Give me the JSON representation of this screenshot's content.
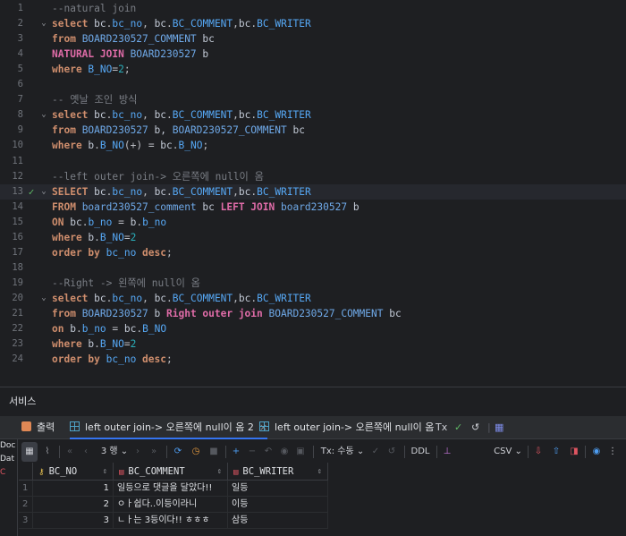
{
  "editor": {
    "lines": [
      {
        "n": "1",
        "fold": "",
        "icon": "",
        "tokens": [
          [
            "cmt",
            "--natural join"
          ]
        ]
      },
      {
        "n": "2",
        "fold": "v",
        "icon": "",
        "tokens": [
          [
            "kw",
            "select "
          ],
          [
            "ident",
            "bc"
          ],
          [
            "punct",
            "."
          ],
          [
            "col",
            "bc_no"
          ],
          [
            "punct",
            ", "
          ],
          [
            "ident",
            "bc"
          ],
          [
            "punct",
            "."
          ],
          [
            "col",
            "BC_COMMENT"
          ],
          [
            "punct",
            ","
          ],
          [
            "ident",
            "bc"
          ],
          [
            "punct",
            "."
          ],
          [
            "col",
            "BC_WRITER"
          ]
        ]
      },
      {
        "n": "3",
        "fold": "",
        "icon": "",
        "tokens": [
          [
            "kw",
            "from "
          ],
          [
            "tbl",
            "BOARD230527_COMMENT"
          ],
          [
            "ident",
            " bc"
          ]
        ]
      },
      {
        "n": "4",
        "fold": "",
        "icon": "",
        "tokens": [
          [
            "kwp",
            "NATURAL JOIN "
          ],
          [
            "tbl",
            "BOARD230527"
          ],
          [
            "ident",
            " b"
          ]
        ]
      },
      {
        "n": "5",
        "fold": "",
        "icon": "",
        "tokens": [
          [
            "kw",
            "where "
          ],
          [
            "col",
            "B_NO"
          ],
          [
            "punct",
            "="
          ],
          [
            "num",
            "2"
          ],
          [
            "punct",
            ";"
          ]
        ]
      },
      {
        "n": "6",
        "fold": "",
        "icon": "",
        "tokens": []
      },
      {
        "n": "7",
        "fold": "",
        "icon": "",
        "tokens": [
          [
            "cmt",
            "-- 옛날 조인 방식"
          ]
        ]
      },
      {
        "n": "8",
        "fold": "v",
        "icon": "",
        "tokens": [
          [
            "kw",
            "select "
          ],
          [
            "ident",
            "bc"
          ],
          [
            "punct",
            "."
          ],
          [
            "col",
            "bc_no"
          ],
          [
            "punct",
            ", "
          ],
          [
            "ident",
            "bc"
          ],
          [
            "punct",
            "."
          ],
          [
            "col",
            "BC_COMMENT"
          ],
          [
            "punct",
            ","
          ],
          [
            "ident",
            "bc"
          ],
          [
            "punct",
            "."
          ],
          [
            "col",
            "BC_WRITER"
          ]
        ]
      },
      {
        "n": "9",
        "fold": "",
        "icon": "",
        "tokens": [
          [
            "kw",
            "from "
          ],
          [
            "tbl",
            "BOARD230527"
          ],
          [
            "ident",
            " b, "
          ],
          [
            "tbl",
            "BOARD230527_COMMENT"
          ],
          [
            "ident",
            " bc"
          ]
        ]
      },
      {
        "n": "10",
        "fold": "",
        "icon": "",
        "tokens": [
          [
            "kw",
            "where "
          ],
          [
            "ident",
            "b"
          ],
          [
            "punct",
            "."
          ],
          [
            "col",
            "B_NO"
          ],
          [
            "punct",
            "(+) = "
          ],
          [
            "ident",
            "bc"
          ],
          [
            "punct",
            "."
          ],
          [
            "col",
            "B_NO"
          ],
          [
            "punct",
            ";"
          ]
        ]
      },
      {
        "n": "11",
        "fold": "",
        "icon": "",
        "tokens": []
      },
      {
        "n": "12",
        "fold": "",
        "icon": "",
        "tokens": [
          [
            "cmt",
            "--left outer join-> 오른쪽에 null이 옴"
          ]
        ]
      },
      {
        "n": "13",
        "fold": "v",
        "icon": "ok",
        "tokens": [
          [
            "kw",
            "SELECT "
          ],
          [
            "ident",
            "bc"
          ],
          [
            "punct",
            "."
          ],
          [
            "col",
            "bc_no"
          ],
          [
            "punct",
            ", "
          ],
          [
            "ident",
            "bc"
          ],
          [
            "punct",
            "."
          ],
          [
            "col",
            "BC_COMMENT"
          ],
          [
            "punct",
            ","
          ],
          [
            "ident",
            "bc"
          ],
          [
            "punct",
            "."
          ],
          [
            "col",
            "BC_WRITER"
          ]
        ]
      },
      {
        "n": "14",
        "fold": "",
        "icon": "",
        "tokens": [
          [
            "kw",
            "FROM "
          ],
          [
            "tbl",
            "board230527_comment"
          ],
          [
            "ident",
            " bc "
          ],
          [
            "kwp",
            "LEFT JOIN "
          ],
          [
            "tbl",
            "board230527"
          ],
          [
            "ident",
            " b"
          ]
        ]
      },
      {
        "n": "15",
        "fold": "",
        "icon": "",
        "tokens": [
          [
            "kw",
            "ON "
          ],
          [
            "ident",
            "bc"
          ],
          [
            "punct",
            "."
          ],
          [
            "col",
            "b_no"
          ],
          [
            "punct",
            " = "
          ],
          [
            "ident",
            "b"
          ],
          [
            "punct",
            "."
          ],
          [
            "col",
            "b_no"
          ]
        ]
      },
      {
        "n": "16",
        "fold": "",
        "icon": "",
        "tokens": [
          [
            "kw",
            "where "
          ],
          [
            "ident",
            "b"
          ],
          [
            "punct",
            "."
          ],
          [
            "col",
            "B_NO"
          ],
          [
            "punct",
            "="
          ],
          [
            "num",
            "2"
          ]
        ]
      },
      {
        "n": "17",
        "fold": "",
        "icon": "",
        "tokens": [
          [
            "kw",
            "order by "
          ],
          [
            "col",
            "bc_no"
          ],
          [
            "kw",
            " desc"
          ],
          [
            "punct",
            ";"
          ]
        ]
      },
      {
        "n": "18",
        "fold": "",
        "icon": "",
        "tokens": []
      },
      {
        "n": "19",
        "fold": "",
        "icon": "",
        "tokens": [
          [
            "cmt",
            "--Right -> 왼쪽에 null이 옴"
          ]
        ]
      },
      {
        "n": "20",
        "fold": "v",
        "icon": "",
        "tokens": [
          [
            "kw",
            "select "
          ],
          [
            "ident",
            "bc"
          ],
          [
            "punct",
            "."
          ],
          [
            "col",
            "bc_no"
          ],
          [
            "punct",
            ", "
          ],
          [
            "ident",
            "bc"
          ],
          [
            "punct",
            "."
          ],
          [
            "col",
            "BC_COMMENT"
          ],
          [
            "punct",
            ","
          ],
          [
            "ident",
            "bc"
          ],
          [
            "punct",
            "."
          ],
          [
            "col",
            "BC_WRITER"
          ]
        ]
      },
      {
        "n": "21",
        "fold": "",
        "icon": "",
        "tokens": [
          [
            "kw",
            "from "
          ],
          [
            "tbl",
            "BOARD230527"
          ],
          [
            "ident",
            " b "
          ],
          [
            "kwp",
            "Right outer join "
          ],
          [
            "tbl",
            "BOARD230527_COMMENT"
          ],
          [
            "ident",
            " bc"
          ]
        ]
      },
      {
        "n": "22",
        "fold": "",
        "icon": "",
        "tokens": [
          [
            "kw",
            "on "
          ],
          [
            "ident",
            "b"
          ],
          [
            "punct",
            "."
          ],
          [
            "col",
            "b_no"
          ],
          [
            "punct",
            " = "
          ],
          [
            "ident",
            "bc"
          ],
          [
            "punct",
            "."
          ],
          [
            "col",
            "B_NO"
          ]
        ]
      },
      {
        "n": "23",
        "fold": "",
        "icon": "",
        "tokens": [
          [
            "kw",
            "where "
          ],
          [
            "ident",
            "b"
          ],
          [
            "punct",
            "."
          ],
          [
            "col",
            "B_NO"
          ],
          [
            "punct",
            "="
          ],
          [
            "num",
            "2"
          ]
        ]
      },
      {
        "n": "24",
        "fold": "",
        "icon": "",
        "tokens": [
          [
            "kw",
            "order by "
          ],
          [
            "col",
            "bc_no"
          ],
          [
            "kw",
            " desc"
          ],
          [
            "punct",
            ";"
          ]
        ]
      }
    ]
  },
  "services": {
    "title": "서비스"
  },
  "tabs": {
    "output_label": "출력",
    "result1_label": "left outer join-> 오른쪽에 null이 옴 2",
    "result2_label": "left outer join-> 오른쪽에 null이 옴",
    "tx_label": "Tx"
  },
  "toolbar": {
    "rows_label": "3 행",
    "tx_mode_label": "Tx: 수동",
    "ddl_label": "DDL",
    "csv_label": "CSV"
  },
  "left_strip": [
    "Doc",
    "Dat",
    "C"
  ],
  "grid": {
    "columns": [
      {
        "name": "BC_NO",
        "icon": "key-icon"
      },
      {
        "name": "BC_COMMENT",
        "icon": "column-icon"
      },
      {
        "name": "BC_WRITER",
        "icon": "column-icon"
      }
    ],
    "rows": [
      {
        "n": "1",
        "bc_no": "1",
        "bc_comment": "일등으로 댓글을 달았다!!",
        "bc_writer": "일등"
      },
      {
        "n": "2",
        "bc_no": "2",
        "bc_comment": "ㅇㅏ쉽다..이등이라니",
        "bc_writer": "이등"
      },
      {
        "n": "3",
        "bc_no": "3",
        "bc_comment": "ㄴㅏ는 3등이다!! ㅎㅎㅎ",
        "bc_writer": "삼등"
      }
    ]
  },
  "colors": {
    "background": "#1e1f22",
    "keyword": "#cf8e6d",
    "accent_blue": "#3574f0",
    "success": "#5fb865"
  }
}
